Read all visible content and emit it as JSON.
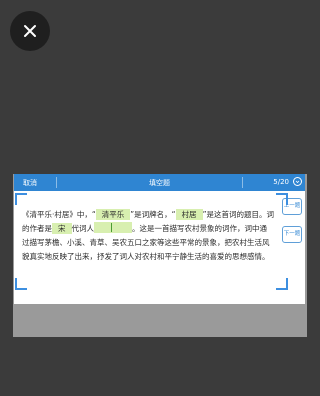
{
  "viewer": {
    "close_icon": "close-icon"
  },
  "app": {
    "cancel_label": "取消",
    "title": "填空题",
    "progress": "5/20",
    "menu_icon": "circle-chevron-icon",
    "prev_label": "上一题",
    "next_label": "下一题"
  },
  "passage": {
    "text_1": "《清平乐·村居》中，“",
    "blank_1": "清平乐",
    "text_2": "”是词牌名，“",
    "blank_2": "村居",
    "text_3": "”是这首词的题目。词的作者是",
    "blank_3": "宋",
    "text_4": "代词人",
    "blank_4_value": "",
    "text_5": "。这是一首描写农村景象的词作，词中通过描写茅檐、小溪、青草、吴农五口之家等这些平常的景象，把农村生活风貌真实地反映了出来，抒发了词人对农村和平宁静生活的喜爱的思想感情。"
  },
  "colors": {
    "background": "#3b3b3b",
    "header": "#2f85d2",
    "blank_fill": "#d8efb0",
    "frame": "#3d8fe0"
  }
}
